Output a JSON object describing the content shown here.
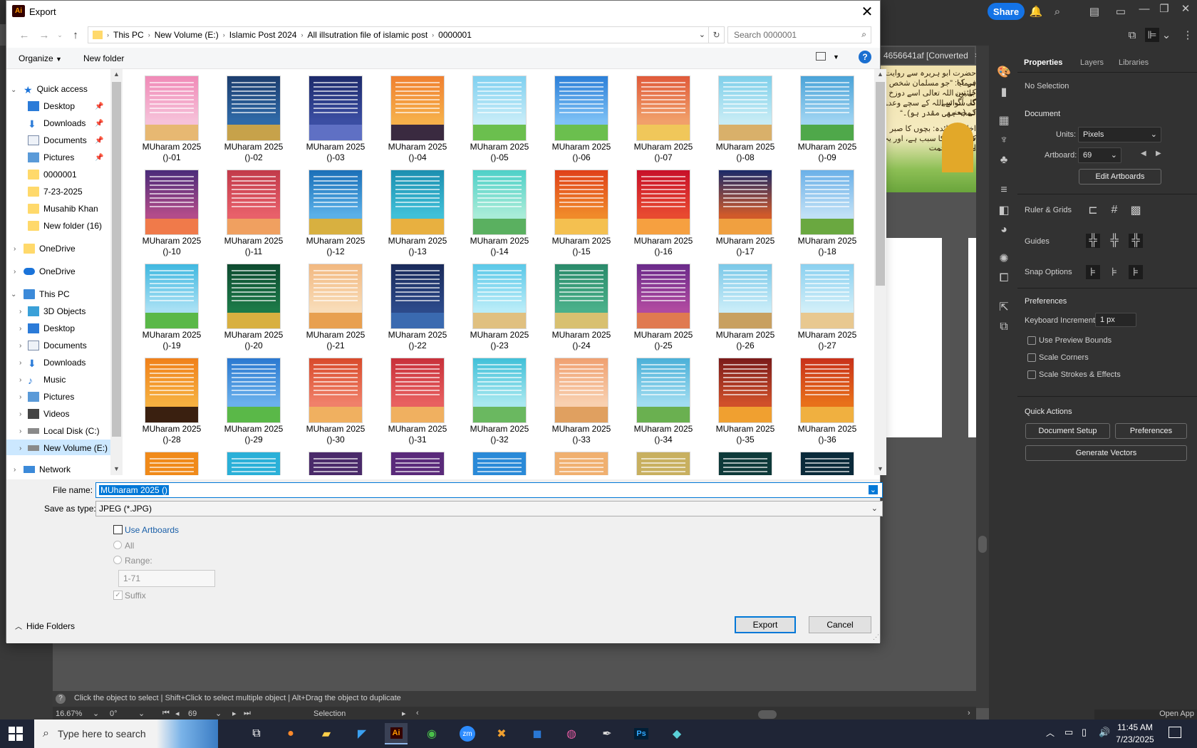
{
  "illustrator": {
    "share_label": "Share",
    "doc_tab_title": "4656641af [Converted",
    "art_text_lines": [
      "حضرت ابو ہریرہ سے روایت ہے کہ",
      "فرمایا: ”جو مسلمان شخص کے تین",
      "جائیں، اللہ تعالی اسے دوزخ کی آگ سے",
      "گا، سوائے اللہ کے سچے وعدے کے (یعنی",
      "لمحہ بھی مقدر ہو)۔“",
      "اخلاقی فائدہ: بچوں کا صبر سے انتقال",
      "کرنا جنت کا سبب ہے، اور یہ اللہ کی رحمت",
      "علامت ہے۔"
    ],
    "panel": {
      "tabs": [
        "Properties",
        "Layers",
        "Libraries"
      ],
      "no_selection": "No Selection",
      "document_heading": "Document",
      "units_label": "Units:",
      "units_value": "Pixels",
      "artboard_label": "Artboard:",
      "artboard_value": "69",
      "edit_artboards": "Edit Artboards",
      "ruler_grids": "Ruler & Grids",
      "guides": "Guides",
      "snap_options": "Snap Options",
      "preferences_heading": "Preferences",
      "keyboard_increment_label": "Keyboard Increment:",
      "keyboard_increment_value": "1 px",
      "use_preview_bounds": "Use Preview Bounds",
      "scale_corners": "Scale Corners",
      "scale_strokes": "Scale Strokes & Effects",
      "quick_actions": "Quick Actions",
      "document_setup": "Document Setup",
      "preferences_btn": "Preferences",
      "generate_vectors": "Generate Vectors"
    },
    "status_hint": "Click the object to select  |  Shift+Click to select multiple object  |  Alt+Drag the object to duplicate",
    "zoom": "16.67%",
    "rotation": "0°",
    "artboard_nav": "69",
    "tool_name": "Selection",
    "open_app": "Open App"
  },
  "dialog": {
    "title": "Export",
    "breadcrumbs": [
      "This PC",
      "New Volume (E:)",
      "Islamic Post 2024",
      "All illsutration file of islamic post",
      "0000001"
    ],
    "search_placeholder": "Search 0000001",
    "organize": "Organize",
    "new_folder": "New folder",
    "nav": {
      "quick_access": "Quick access",
      "quick_items": [
        "Desktop",
        "Downloads",
        "Documents",
        "Pictures",
        "0000001",
        "7-23-2025",
        "Musahib Khan",
        "New folder (16)"
      ],
      "onedrive1": "OneDrive",
      "onedrive2": "OneDrive",
      "this_pc": "This PC",
      "pc_items": [
        "3D Objects",
        "Desktop",
        "Documents",
        "Downloads",
        "Music",
        "Pictures",
        "Videos",
        "Local Disk (C:)",
        "New Volume (E:)"
      ],
      "network": "Network"
    },
    "files": [
      {
        "line1": "MUharam 2025",
        "line2": "()-01"
      },
      {
        "line1": "MUharam 2025",
        "line2": "()-02"
      },
      {
        "line1": "MUharam 2025",
        "line2": "()-03"
      },
      {
        "line1": "MUharam 2025",
        "line2": "()-04"
      },
      {
        "line1": "MUharam 2025",
        "line2": "()-05"
      },
      {
        "line1": "MUharam 2025",
        "line2": "()-06"
      },
      {
        "line1": "MUharam 2025",
        "line2": "()-07"
      },
      {
        "line1": "MUharam 2025",
        "line2": "()-08"
      },
      {
        "line1": "MUharam 2025",
        "line2": "()-09"
      },
      {
        "line1": "MUharam 2025",
        "line2": "()-10"
      },
      {
        "line1": "MUharam 2025",
        "line2": "()-11"
      },
      {
        "line1": "MUharam 2025",
        "line2": "()-12"
      },
      {
        "line1": "MUharam 2025",
        "line2": "()-13"
      },
      {
        "line1": "MUharam 2025",
        "line2": "()-14"
      },
      {
        "line1": "MUharam 2025",
        "line2": "()-15"
      },
      {
        "line1": "MUharam 2025",
        "line2": "()-16"
      },
      {
        "line1": "MUharam 2025",
        "line2": "()-17"
      },
      {
        "line1": "MUharam 2025",
        "line2": "()-18"
      },
      {
        "line1": "MUharam 2025",
        "line2": "()-19"
      },
      {
        "line1": "MUharam 2025",
        "line2": "()-20"
      },
      {
        "line1": "MUharam 2025",
        "line2": "()-21"
      },
      {
        "line1": "MUharam 2025",
        "line2": "()-22"
      },
      {
        "line1": "MUharam 2025",
        "line2": "()-23"
      },
      {
        "line1": "MUharam 2025",
        "line2": "()-24"
      },
      {
        "line1": "MUharam 2025",
        "line2": "()-25"
      },
      {
        "line1": "MUharam 2025",
        "line2": "()-26"
      },
      {
        "line1": "MUharam 2025",
        "line2": "()-27"
      },
      {
        "line1": "MUharam 2025",
        "line2": "()-28"
      },
      {
        "line1": "MUharam 2025",
        "line2": "()-29"
      },
      {
        "line1": "MUharam 2025",
        "line2": "()-30"
      },
      {
        "line1": "MUharam 2025",
        "line2": "()-31"
      },
      {
        "line1": "MUharam 2025",
        "line2": "()-32"
      },
      {
        "line1": "MUharam 2025",
        "line2": "()-33"
      },
      {
        "line1": "MUharam 2025",
        "line2": "()-34"
      },
      {
        "line1": "MUharam 2025",
        "line2": "()-35"
      },
      {
        "line1": "MUharam 2025",
        "line2": "()-36"
      }
    ],
    "thumb_palettes": [
      [
        "#f08ab7",
        "#f6c1d9",
        "#e7b872"
      ],
      [
        "#1c3d6e",
        "#2f6aa8",
        "#c7a24a"
      ],
      [
        "#1d2a6b",
        "#3b4ea3",
        "#5f70c4"
      ],
      [
        "#f08030",
        "#f6b04a",
        "#3a2a40"
      ],
      [
        "#7fd0f0",
        "#c6ecf8",
        "#6bbf4e"
      ],
      [
        "#2c7fd8",
        "#7cc0f5",
        "#6bbf4e"
      ],
      [
        "#e05a3a",
        "#f1a06a",
        "#f0c75a"
      ],
      [
        "#7ecfea",
        "#c7ecf5",
        "#d9b06a"
      ],
      [
        "#4aa3d8",
        "#9fd4f2",
        "#4fa84a"
      ],
      [
        "#4a2b7a",
        "#b34c8a",
        "#f07a4a"
      ],
      [
        "#c23a4a",
        "#e8606a",
        "#f0a060"
      ],
      [
        "#1a6fb8",
        "#5ab0e8",
        "#d8b040"
      ],
      [
        "#1c8fb0",
        "#40c0d8",
        "#e8b040"
      ],
      [
        "#4ed0c8",
        "#a8ecd8",
        "#5ab060"
      ],
      [
        "#e0401a",
        "#f08a2a",
        "#f4c050"
      ],
      [
        "#c8102a",
        "#e84a30",
        "#f6a040"
      ],
      [
        "#1a2a6a",
        "#d05a2a",
        "#f0a040"
      ],
      [
        "#6ab0e8",
        "#c0e0f6",
        "#6aa840"
      ],
      [
        "#40b8e0",
        "#a8e0f4",
        "#5ab848"
      ],
      [
        "#0e4a30",
        "#1c7a48",
        "#d8b040"
      ],
      [
        "#f2b880",
        "#f8dcb8",
        "#e8a050"
      ],
      [
        "#1a2a5a",
        "#2c4a8a",
        "#3a6ab0"
      ],
      [
        "#5ac8e8",
        "#b8ecf8",
        "#e0c080"
      ],
      [
        "#2a8a6a",
        "#4ab08a",
        "#d8c070"
      ],
      [
        "#6a2a8a",
        "#b04aa0",
        "#e07a50"
      ],
      [
        "#7ac8e8",
        "#c8ecf8",
        "#c8a060"
      ],
      [
        "#8ad0f0",
        "#d0eef8",
        "#e8c890"
      ],
      [
        "#f0801a",
        "#f6b040",
        "#3a2010"
      ],
      [
        "#2a78d0",
        "#6ab0ec",
        "#5ab848"
      ],
      [
        "#d84a2a",
        "#f0806a",
        "#f0b060"
      ],
      [
        "#c8303a",
        "#e86060",
        "#f0b060"
      ],
      [
        "#40c0d8",
        "#a8e8f0",
        "#6ab860"
      ],
      [
        "#f0a070",
        "#f8d0b0",
        "#e0a060"
      ],
      [
        "#4ab0d8",
        "#a0dcf0",
        "#6ab050"
      ],
      [
        "#7a1a1a",
        "#d0502a",
        "#f0a030"
      ],
      [
        "#c8301a",
        "#e8701a",
        "#f0b040"
      ]
    ],
    "file_name_label": "File name:",
    "file_name_value": "MUharam 2025 ()",
    "save_type_label": "Save as type:",
    "save_type_value": "JPEG (*.JPG)",
    "use_artboards": "Use Artboards",
    "all": "All",
    "range": "Range:",
    "range_value": "1-71",
    "suffix": "Suffix",
    "hide_folders": "Hide Folders",
    "export": "Export",
    "cancel": "Cancel"
  },
  "taskbar": {
    "search_placeholder": "Type here to search",
    "time": "11:45 AM",
    "date": "7/23/2025"
  }
}
